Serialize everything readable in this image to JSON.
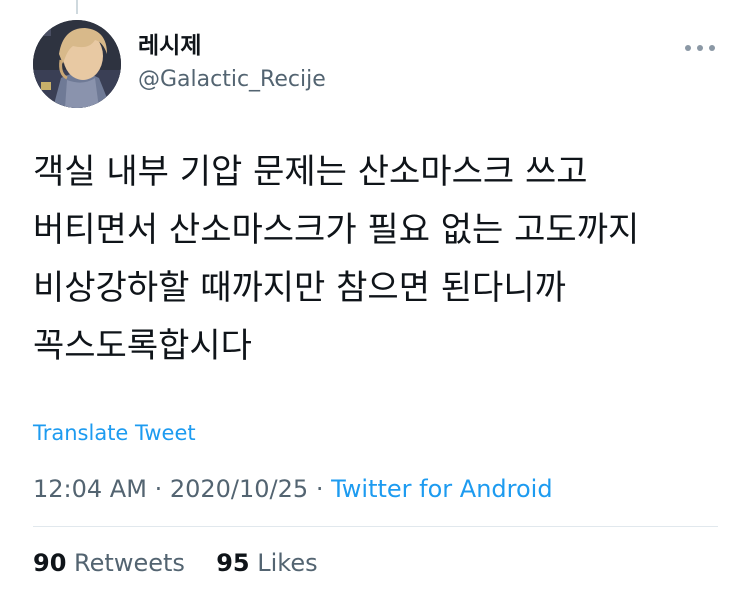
{
  "author": {
    "display_name": "레시제",
    "handle": "@Galactic_Recije"
  },
  "tweet": {
    "text": "객실 내부 기압 문제는 산소마스크 쓰고 버티면서 산소마스크가 필요 없는 고도까지 비상강하할 때까지만 참으면 된다니까 꼭스도록합시다",
    "translate_label": "Translate Tweet"
  },
  "meta": {
    "time": "12:04 AM",
    "separator": "·",
    "date": "2020/10/25",
    "source": "Twitter for Android"
  },
  "stats": {
    "retweets_count": "90",
    "retweets_label": "Retweets",
    "likes_count": "95",
    "likes_label": "Likes"
  },
  "icons": {
    "more": "more-horizontal-icon"
  },
  "colors": {
    "link": "#1d9bf0",
    "secondary_text": "#536471",
    "primary_text": "#0f1419"
  }
}
